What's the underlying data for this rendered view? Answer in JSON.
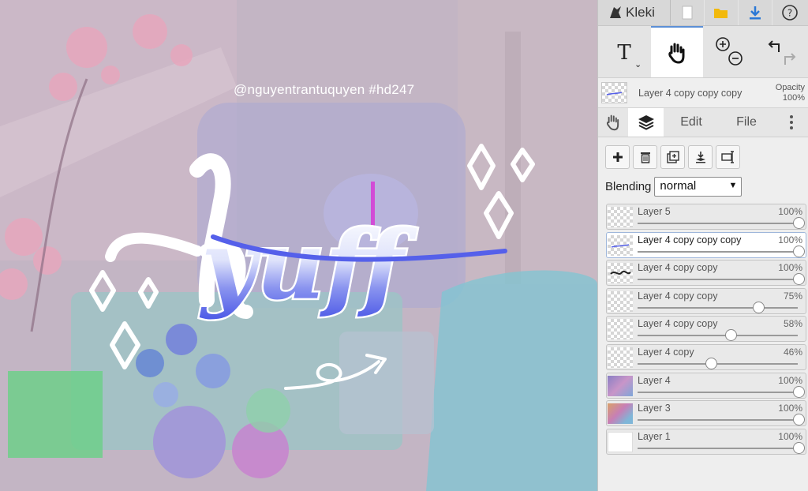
{
  "app": {
    "name": "Kleki"
  },
  "canvas": {
    "watermark": "@nguyentrantuquyen  #hd247"
  },
  "toolbar": {
    "current_tool": "hand",
    "tools": [
      "text",
      "hand",
      "zoom",
      "undo-redo"
    ]
  },
  "active_layer": {
    "name": "Layer 4 copy copy copy",
    "opacity_label": "Opacity",
    "opacity_value": "100%"
  },
  "tabs": {
    "edit": "Edit",
    "file": "File"
  },
  "blending": {
    "label": "Blending",
    "value": "normal"
  },
  "layers": [
    {
      "name": "Layer 5",
      "opacity": "100%",
      "level": 1.0,
      "thumb": "empty"
    },
    {
      "name": "Layer 4 copy copy copy",
      "opacity": "100%",
      "level": 1.0,
      "thumb": "stroke",
      "selected": true
    },
    {
      "name": "Layer 4 copy copy",
      "opacity": "100%",
      "level": 1.0,
      "thumb": "text"
    },
    {
      "name": "Layer 4 copy copy",
      "opacity": "75%",
      "level": 0.75,
      "thumb": "empty"
    },
    {
      "name": "Layer 4 copy copy",
      "opacity": "58%",
      "level": 0.58,
      "thumb": "empty"
    },
    {
      "name": "Layer 4 copy",
      "opacity": "46%",
      "level": 0.46,
      "thumb": "empty"
    },
    {
      "name": "Layer 4",
      "opacity": "100%",
      "level": 1.0,
      "thumb": "photo-purple"
    },
    {
      "name": "Layer 3",
      "opacity": "100%",
      "level": 1.0,
      "thumb": "photo-warm"
    },
    {
      "name": "Layer 1",
      "opacity": "100%",
      "level": 1.0,
      "thumb": "white"
    }
  ],
  "colors": {
    "accent": "#5c8fd6",
    "download": "#2a78d6",
    "folder": "#f2b90c"
  }
}
